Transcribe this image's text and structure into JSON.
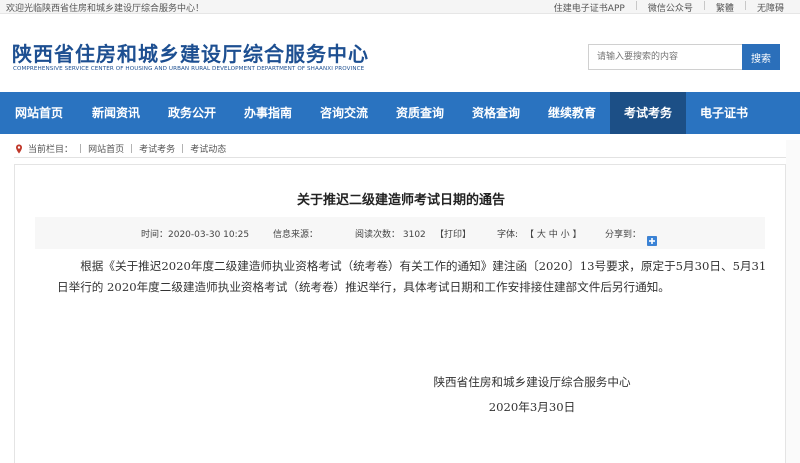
{
  "topbar": {
    "welcome": "欢迎光临陕西省住房和城乡建设厅综合服务中心！",
    "links": [
      "住建电子证书APP",
      "微信公众号",
      "繁體",
      "无障碍"
    ]
  },
  "header": {
    "title": "陕西省住房和城乡建设厅综合服务中心",
    "subtitle": "COMPREHENSIVE SERVICE CENTER OF HOUSING AND URBAN RURAL DEVELOPMENT DEPARTMENT OF SHAANXI PROVINCE",
    "search_placeholder": "请输入要搜索的内容",
    "search_button": "搜索"
  },
  "nav": {
    "items": [
      "网站首页",
      "新闻资讯",
      "政务公开",
      "办事指南",
      "咨询交流",
      "资质查询",
      "资格查询",
      "继续教育",
      "考试考务",
      "电子证书"
    ],
    "active_index": 8
  },
  "breadcrumb": {
    "label": "当前栏目：",
    "items": [
      "网站首页",
      "考试考务",
      "考试动态"
    ]
  },
  "article": {
    "title": "关于推迟二级建造师考试日期的通告",
    "meta": {
      "time": "时间：2020-03-30 10:25",
      "source": "信息来源：",
      "views": "阅读次数： 3102",
      "print": "【打印】",
      "font_label": "字体:",
      "font_sizes": "【 大  中  小 】",
      "share_label": "分享到："
    },
    "body": "根据《关于推迟2020年度二级建造师执业资格考试（统考卷）有关工作的通知》建注函〔2020〕13号要求，原定于5月30日、5月31日举行的 2020年度二级建造师执业资格考试（统考卷）推迟举行，具体考试日期和工作安排接住建部文件后另行通知。",
    "signer": "陕西省住房和城乡建设厅综合服务中心",
    "date": "2020年3月30日"
  },
  "colors": {
    "nav": "#2a73c0",
    "nav_active": "#1c4f86",
    "title": "#1d4f91",
    "search_button": "#2b6fba"
  }
}
